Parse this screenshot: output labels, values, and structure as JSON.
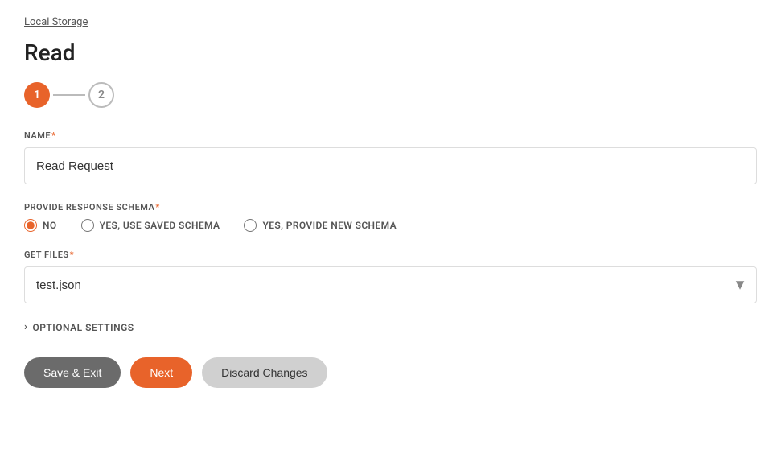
{
  "breadcrumb": {
    "label": "Local Storage"
  },
  "page": {
    "title": "Read"
  },
  "steps": {
    "step1": {
      "label": "1",
      "active": true
    },
    "step2": {
      "label": "2",
      "active": false
    },
    "connector": ""
  },
  "fields": {
    "name": {
      "label": "NAME",
      "required": "*",
      "value": "Read Request",
      "placeholder": ""
    },
    "response_schema": {
      "label": "PROVIDE RESPONSE SCHEMA",
      "required": "*",
      "options": [
        {
          "id": "no",
          "label": "NO",
          "checked": true
        },
        {
          "id": "yes-saved",
          "label": "YES, USE SAVED SCHEMA",
          "checked": false
        },
        {
          "id": "yes-new",
          "label": "YES, PROVIDE NEW SCHEMA",
          "checked": false
        }
      ]
    },
    "get_files": {
      "label": "GET FILES",
      "required": "*",
      "value": "test.json",
      "icon": "▼"
    }
  },
  "optional_settings": {
    "label": "OPTIONAL SETTINGS"
  },
  "buttons": {
    "save_exit": "Save & Exit",
    "next": "Next",
    "discard": "Discard Changes"
  }
}
